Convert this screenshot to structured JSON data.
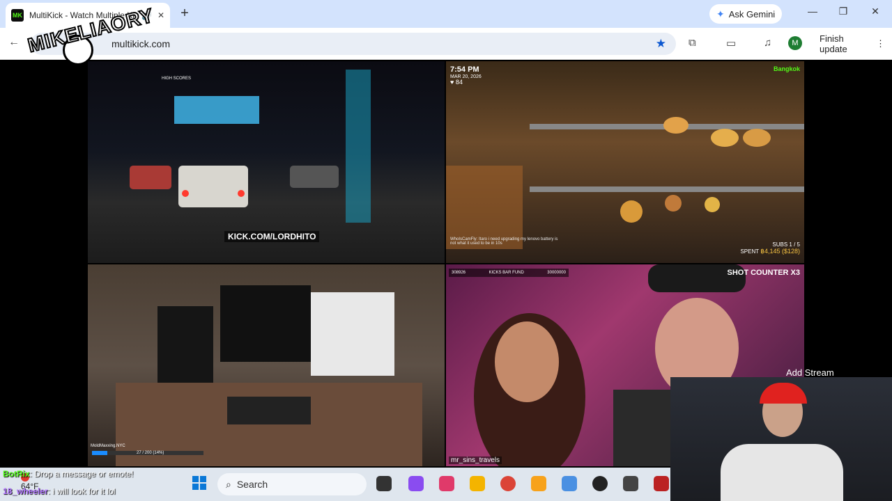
{
  "browser": {
    "tab_title": "MultiKick - Watch Multiple Kick Streams",
    "tab_favicon_text": "MK",
    "new_tab_icon": "plus-icon",
    "gemini_label": "Ask Gemini",
    "url": "multikick.com",
    "finish_update_label": "Finish update",
    "profile_initial": "M"
  },
  "overlay_logo": "MIKELIAORY",
  "streams": [
    {
      "kick_url": "KICK.COM/LORDHITO",
      "high_scores_label": "HIGH SCORES"
    },
    {
      "time": "7:54 PM",
      "date": "MAR 20, 2026",
      "hearts": "84",
      "location": "Bangkok",
      "subs_label": "SUBS",
      "subs_count": "1 / 5",
      "spent_label": "SPENT",
      "spent_amount": "฿4,145 ($128)",
      "chat_snippet": "WhoIsCamFly: Itaro i need upgrading my lenovo battery is not what it used to be in 10s"
    },
    {
      "nameplate": "MoldMaxxing.NYC",
      "progress_text": "27 / 200 (14%)",
      "progress_fraction": 0.14
    },
    {
      "fund_label": "KICKS BAR FUND",
      "fund_current": "308926",
      "fund_goal": "30000000",
      "shot_counter": "SHOT COUNTER X3",
      "handle": "mr_sins_travels"
    }
  ],
  "add_stream_label": "Add Stream",
  "chat": [
    {
      "user": "BotRix",
      "message": ": Drop a message or emote!"
    },
    {
      "user": "18_wheeler",
      "message": ": i will look for it lol"
    }
  ],
  "taskbar": {
    "temperature": "64°F",
    "search_label": "Search"
  },
  "colors": {
    "kick_green": "#53fc18",
    "chrome_tabbar": "#d3e3fd",
    "bookmark_blue": "#0b57d0"
  }
}
